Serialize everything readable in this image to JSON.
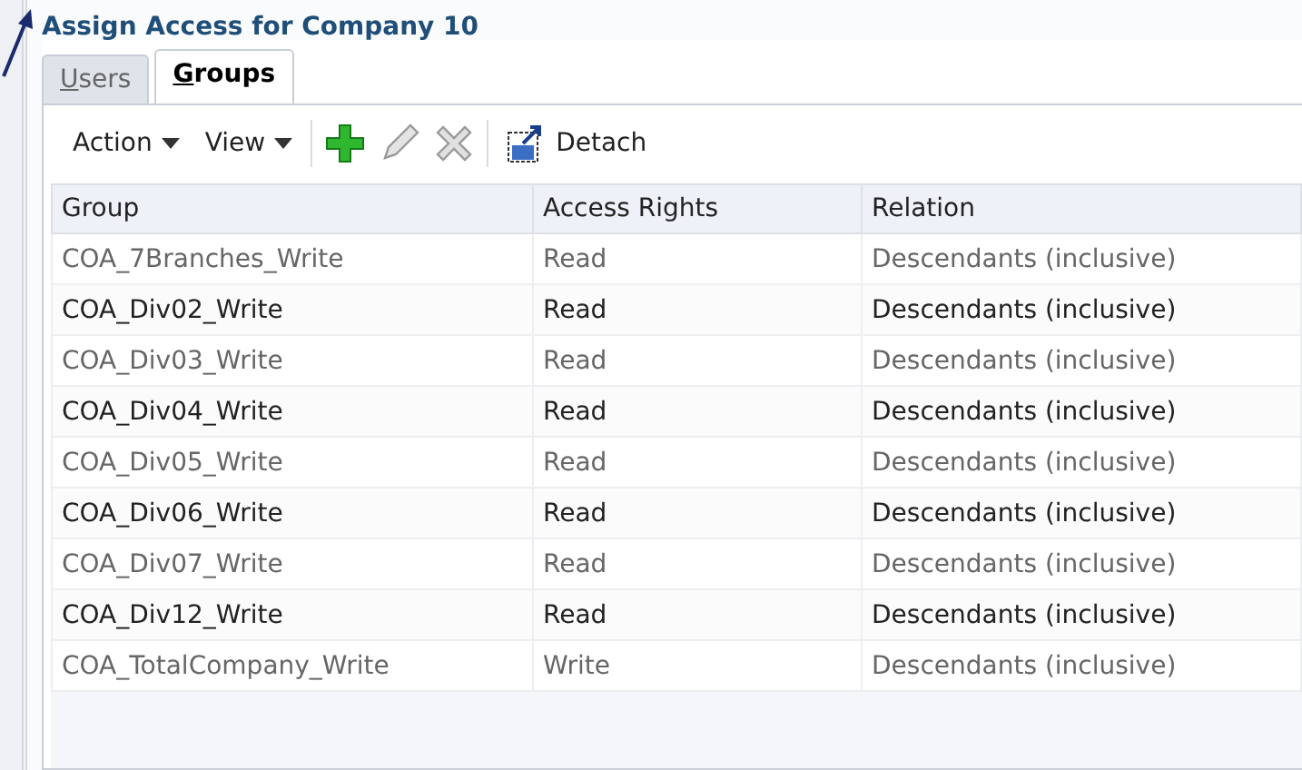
{
  "window": {
    "title": "Assign Access for Company 10"
  },
  "tabs": [
    {
      "mnemonic": "U",
      "rest": "sers",
      "selected": false
    },
    {
      "mnemonic": "G",
      "rest": "roups",
      "selected": true
    }
  ],
  "toolbar": {
    "menus": [
      "Action",
      "View"
    ],
    "detach": "Detach"
  },
  "table": {
    "columns": [
      "Group",
      "Access Rights",
      "Relation"
    ],
    "rows": [
      [
        "COA_7Branches_Write",
        "Read",
        "Descendants (inclusive)"
      ],
      [
        "COA_Div02_Write",
        "Read",
        "Descendants (inclusive)"
      ],
      [
        "COA_Div03_Write",
        "Read",
        "Descendants (inclusive)"
      ],
      [
        "COA_Div04_Write",
        "Read",
        "Descendants (inclusive)"
      ],
      [
        "COA_Div05_Write",
        "Read",
        "Descendants (inclusive)"
      ],
      [
        "COA_Div06_Write",
        "Read",
        "Descendants (inclusive)"
      ],
      [
        "COA_Div07_Write",
        "Read",
        "Descendants (inclusive)"
      ],
      [
        "COA_Div12_Write",
        "Read",
        "Descendants (inclusive)"
      ],
      [
        "COA_TotalCompany_Write",
        "Write",
        "Descendants (inclusive)"
      ]
    ]
  }
}
